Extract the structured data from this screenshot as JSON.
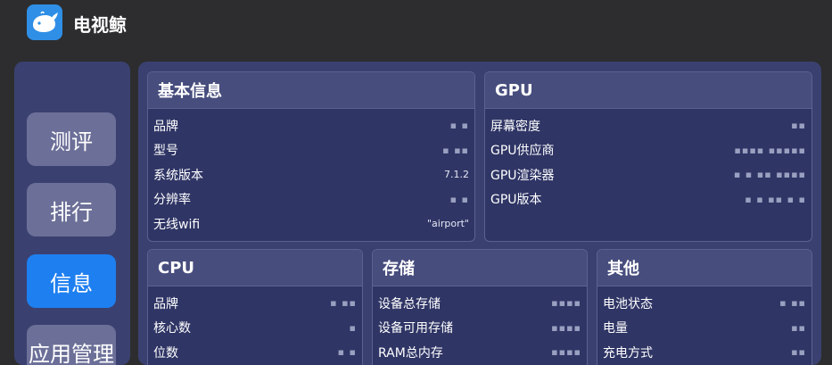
{
  "app": {
    "title": "电视鲸"
  },
  "sidebar": {
    "items": [
      {
        "label": "测评",
        "active": false
      },
      {
        "label": "排行",
        "active": false
      },
      {
        "label": "信息",
        "active": true
      },
      {
        "label": "应用管理",
        "active": false
      }
    ]
  },
  "cards": {
    "basic": {
      "title": "基本信息",
      "rows": [
        {
          "label": "品牌",
          "value": "▪ ▪"
        },
        {
          "label": "型号",
          "value": "▪ ▪▪"
        },
        {
          "label": "系统版本",
          "value": "7.1.2"
        },
        {
          "label": "分辨率",
          "value": "▪   ▪"
        },
        {
          "label": "无线wifi",
          "value": "\"airport\""
        }
      ]
    },
    "gpu": {
      "title": "GPU",
      "rows": [
        {
          "label": "屏幕密度",
          "value": "▪▪"
        },
        {
          "label": "GPU供应商",
          "value": "▪▪▪▪ ▪▪▪▪▪"
        },
        {
          "label": "GPU渲染器",
          "value": "▪  ▪ ▪▪ ▪▪▪▪"
        },
        {
          "label": "GPU版本",
          "value": "▪ ▪ ▪▪ ▪ ▪"
        }
      ]
    },
    "cpu": {
      "title": "CPU",
      "rows": [
        {
          "label": "品牌",
          "value": "▪ ▪▪"
        },
        {
          "label": "核心数",
          "value": "▪"
        },
        {
          "label": "位数",
          "value": "▪ ▪"
        }
      ]
    },
    "storage": {
      "title": "存储",
      "rows": [
        {
          "label": "设备总存储",
          "value": "▪▪▪▪"
        },
        {
          "label": "设备可用存储",
          "value": "▪▪▪▪"
        },
        {
          "label": "RAM总内存",
          "value": "▪▪▪▪"
        }
      ]
    },
    "other": {
      "title": "其他",
      "rows": [
        {
          "label": "电池状态",
          "value": "▪ ▪▪"
        },
        {
          "label": "电量",
          "value": "▪▪"
        },
        {
          "label": "充电方式",
          "value": "▪▪"
        }
      ]
    }
  },
  "colors": {
    "background": "#2d2d2f",
    "panel": "#3a4170",
    "card": "#2f3565",
    "card_header": "#474d7d",
    "nav_button": "#6c7098",
    "nav_active": "#1e7ff0",
    "logo": "#2f8fe6"
  },
  "icons": {
    "logo": "whale-icon"
  }
}
